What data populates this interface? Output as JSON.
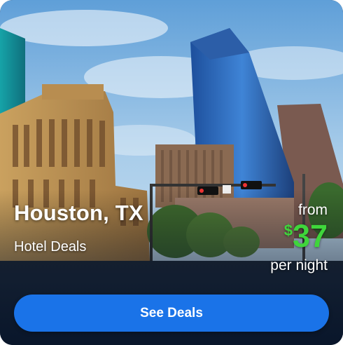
{
  "card": {
    "city": "Houston, TX",
    "subtitle": "Hotel Deals",
    "from_label": "from",
    "currency_symbol": "$",
    "price": "37",
    "per_night_label": "per night",
    "button_label": "See Deals"
  },
  "colors": {
    "button": "#1a73e8",
    "price": "#3fd63b",
    "text": "#ffffff"
  }
}
